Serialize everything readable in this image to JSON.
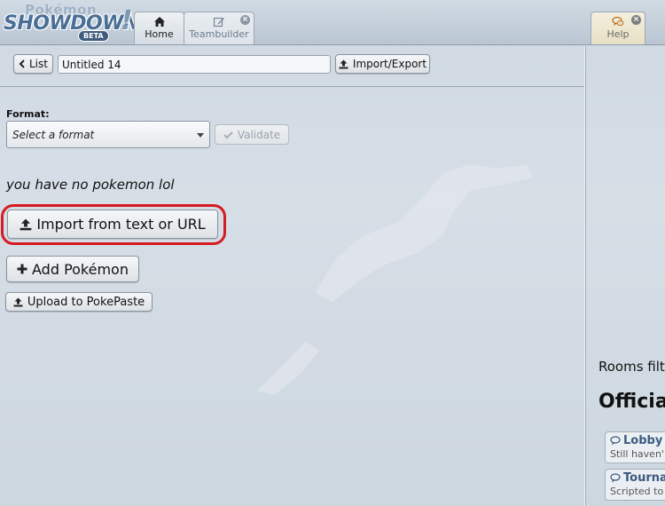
{
  "app": {
    "logo_top": "Pokémon",
    "logo_main": "SHOWDOWN",
    "logo_badge": "BETA"
  },
  "tabs": [
    {
      "label": "Home",
      "icon": "home-icon",
      "active": false
    },
    {
      "label": "Teambuilder",
      "icon": "edit-icon",
      "active": true,
      "closable": true
    },
    {
      "label": "Help",
      "icon": "chat-bubbles-icon",
      "closable": true
    }
  ],
  "teambuilder": {
    "back_label": "List",
    "team_name": "Untitled 14",
    "import_export_label": "Import/Export",
    "format_label": "Format:",
    "format_placeholder": "Select a format",
    "validate_label": "Validate",
    "empty_message": "you have no pokemon lol",
    "import_text_label": "Import from text or URL",
    "add_pokemon_label": "Add Pokémon",
    "upload_label": "Upload to PokePaste"
  },
  "sidebar": {
    "rooms_filter_label": "Rooms filt",
    "official_heading": "Officia",
    "rooms": [
      {
        "name": "Lobby",
        "desc": "Still haven'"
      },
      {
        "name": "Tourna",
        "desc": "Scripted to"
      }
    ]
  },
  "colors": {
    "highlight": "#d61b23",
    "room_name": "#3b5a80",
    "header_bg": "#b9c6d2"
  }
}
